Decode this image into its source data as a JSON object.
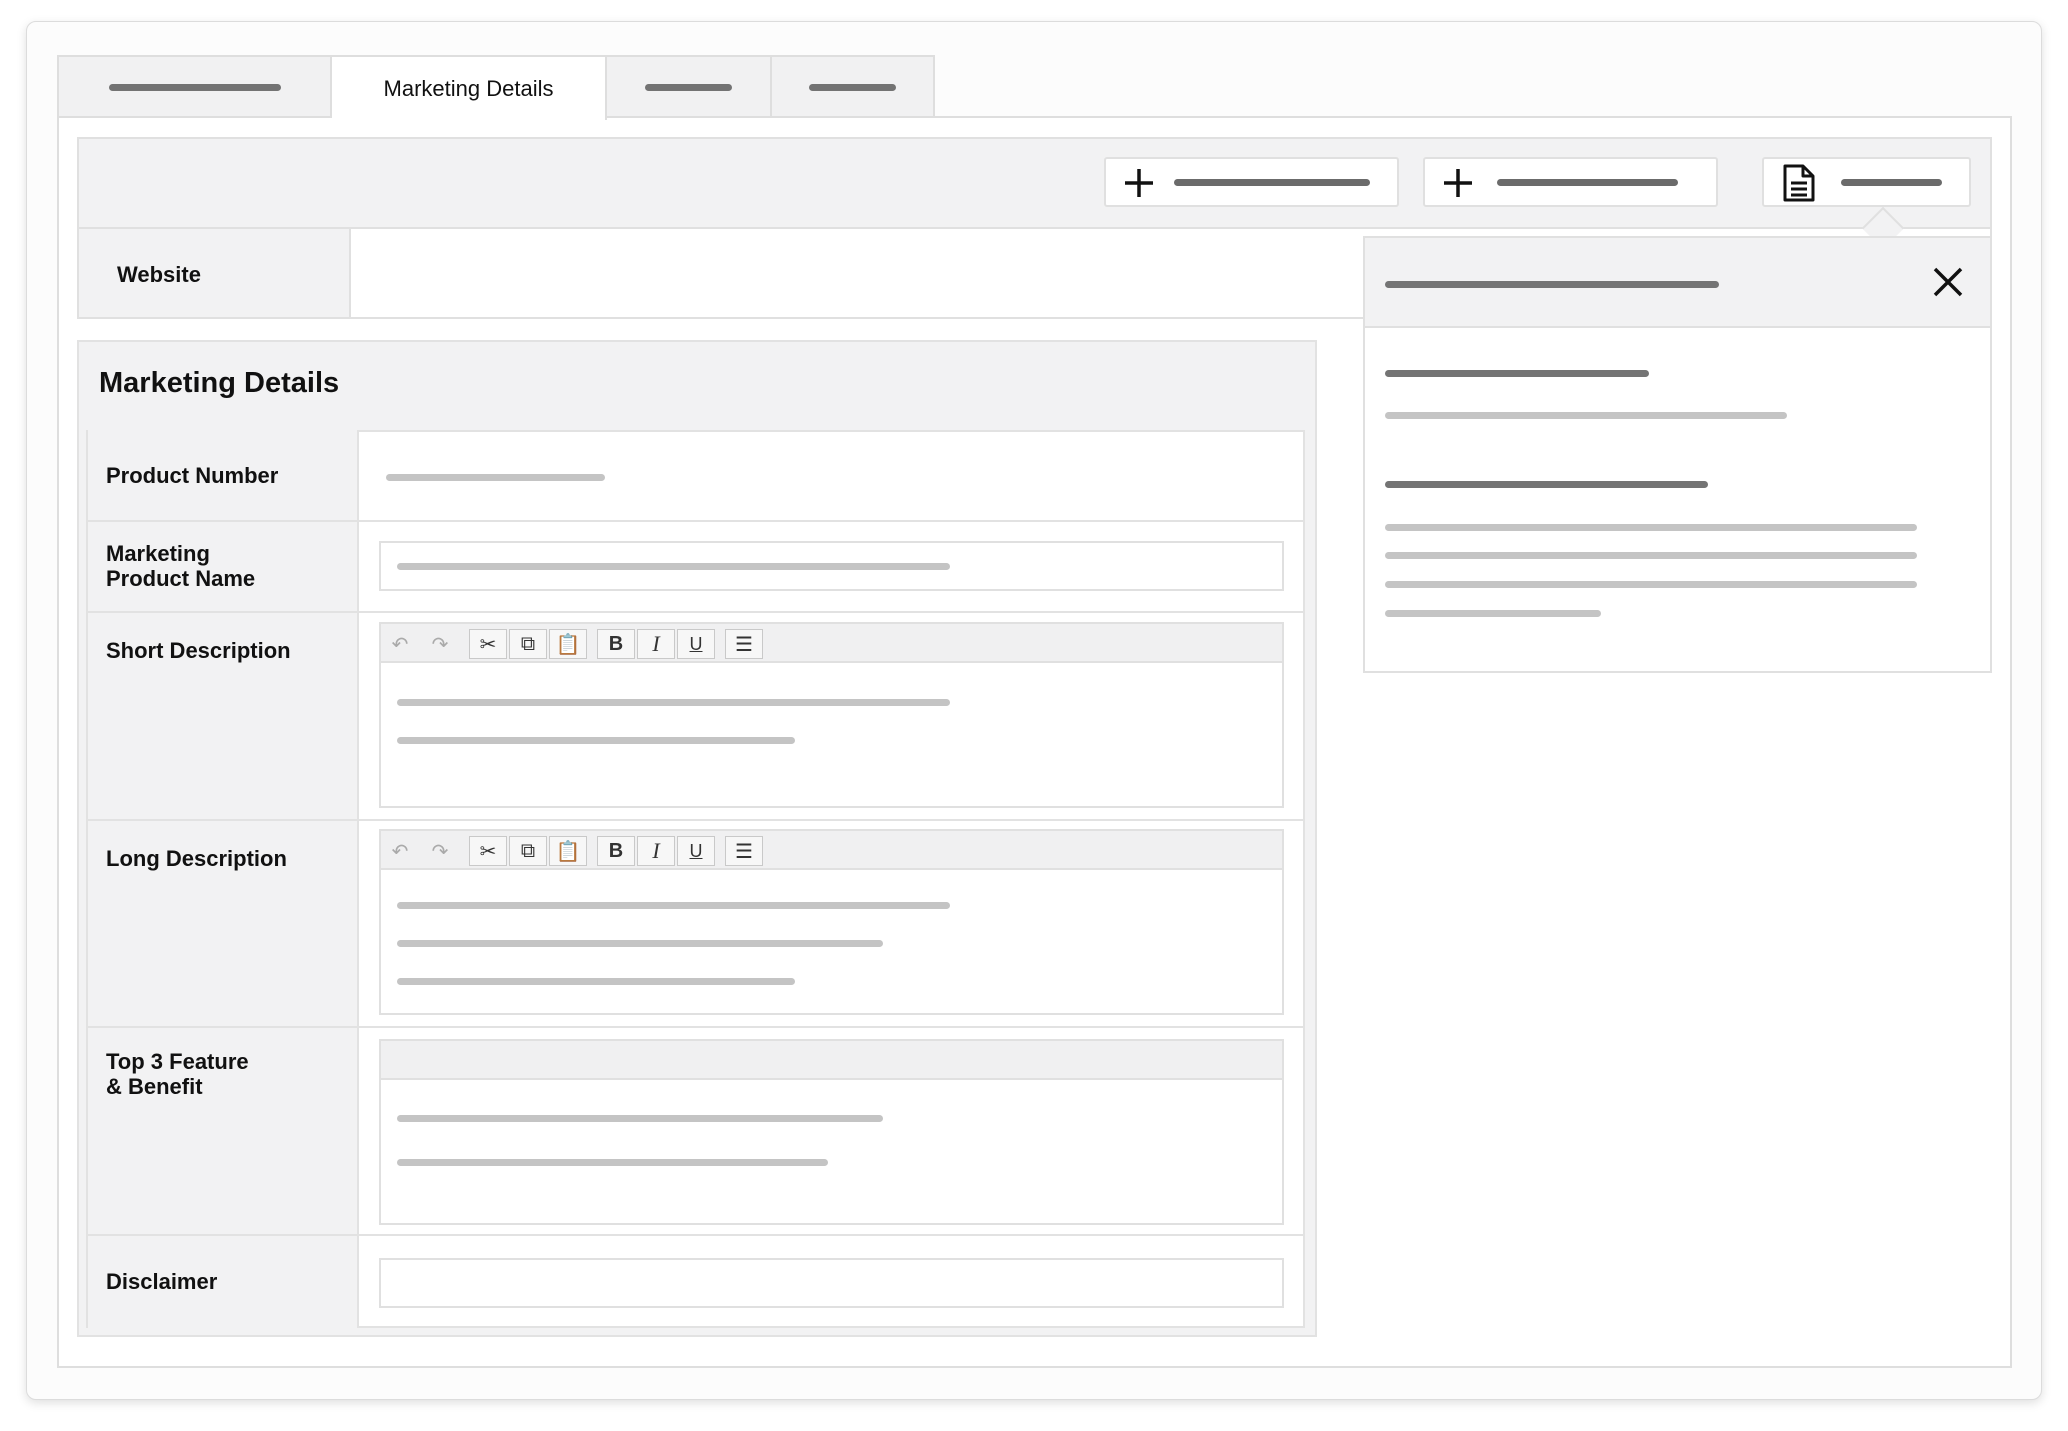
{
  "tabs": [
    {
      "label": "",
      "active": false
    },
    {
      "label": "Marketing Details",
      "active": true
    },
    {
      "label": "",
      "active": false
    },
    {
      "label": "",
      "active": false
    }
  ],
  "toolbar": {
    "buttons": [
      {
        "icon": "plus-icon",
        "label": ""
      },
      {
        "icon": "plus-icon",
        "label": ""
      },
      {
        "icon": "document-icon",
        "label": ""
      }
    ]
  },
  "website": {
    "label": "Website",
    "value": ""
  },
  "marketing_details": {
    "title": "Marketing Details",
    "fields": {
      "product_number": {
        "label": "Product Number",
        "value": ""
      },
      "marketing_product_name": {
        "label_line1": "Marketing",
        "label_line2": "Product Name",
        "value": ""
      },
      "short_description": {
        "label": "Short Description",
        "value": ""
      },
      "long_description": {
        "label": "Long Description",
        "value": ""
      },
      "top3_feature_benefit": {
        "label_line1": "Top 3 Feature",
        "label_line2": "& Benefit",
        "value": ""
      },
      "disclaimer": {
        "label": "Disclaimer",
        "value": ""
      }
    }
  },
  "editor_toolbar": {
    "bold": "B",
    "italic": "I",
    "underline": "U"
  },
  "popover": {
    "title": "",
    "sections": []
  },
  "colors": {
    "panel_bg": "#f2f2f3",
    "border": "#e0e0e0",
    "placeholder_dark": "#747474",
    "placeholder_light": "#c4c4c4"
  }
}
